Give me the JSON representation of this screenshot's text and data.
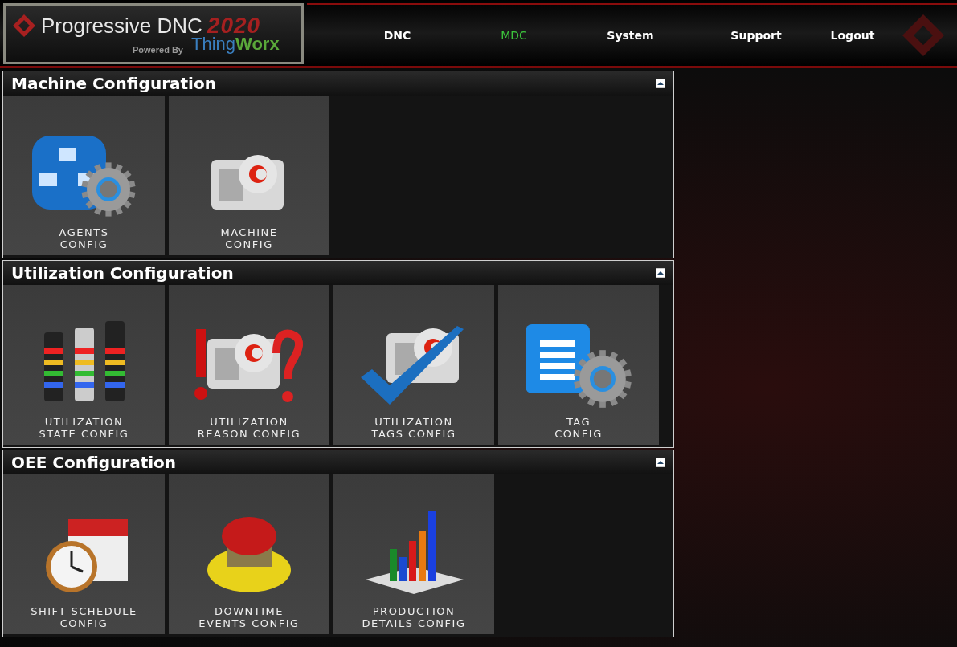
{
  "logo": {
    "title": "Progressive DNC",
    "year": "2020",
    "powered_by": "Powered By",
    "partner_first": "Thing",
    "partner_second": "Worx"
  },
  "nav": [
    {
      "label": "DNC",
      "selected": false
    },
    {
      "label": "MDC",
      "selected": true
    },
    {
      "label": "System",
      "selected": false
    },
    {
      "label": "Support",
      "selected": false
    },
    {
      "label": "Logout",
      "selected": false
    }
  ],
  "sections": [
    {
      "title": "Machine Configuration",
      "expanded": true,
      "tiles": [
        {
          "kind": "agents",
          "lines": [
            "AGENTS",
            "CONFIG"
          ]
        },
        {
          "kind": "machine",
          "lines": [
            "MACHINE",
            "CONFIG"
          ]
        }
      ]
    },
    {
      "title": "Utilization Configuration",
      "expanded": true,
      "tiles": [
        {
          "kind": "lights",
          "lines": [
            "UTILIZATION",
            "STATE CONFIG"
          ]
        },
        {
          "kind": "reason",
          "lines": [
            "UTILIZATION",
            "REASON CONFIG"
          ]
        },
        {
          "kind": "check",
          "lines": [
            "UTILIZATION",
            "TAGS CONFIG"
          ]
        },
        {
          "kind": "tag",
          "lines": [
            "TAG",
            "CONFIG"
          ]
        }
      ]
    },
    {
      "title": "OEE Configuration",
      "expanded": true,
      "tiles": [
        {
          "kind": "calendar",
          "lines": [
            "SHIFT SCHEDULE",
            "CONFIG"
          ]
        },
        {
          "kind": "stop",
          "lines": [
            "DOWNTIME",
            "EVENTS CONFIG"
          ]
        },
        {
          "kind": "chart",
          "lines": [
            "PRODUCTION",
            "DETAILS CONFIG"
          ]
        }
      ]
    }
  ]
}
